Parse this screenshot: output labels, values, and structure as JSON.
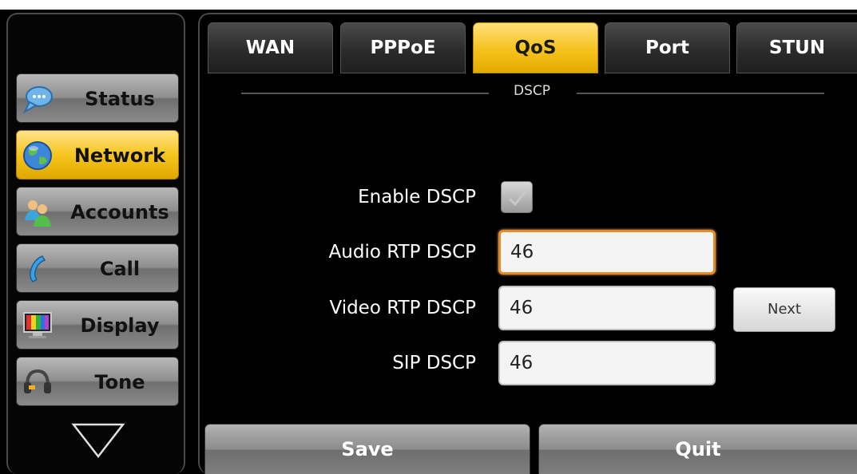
{
  "sidebar": {
    "items": [
      {
        "label": "Status",
        "icon": "speech-bubble-icon",
        "active": false
      },
      {
        "label": "Network",
        "icon": "globe-icon",
        "active": true
      },
      {
        "label": "Accounts",
        "icon": "users-icon",
        "active": false
      },
      {
        "label": "Call",
        "icon": "phone-handset-icon",
        "active": false
      },
      {
        "label": "Display",
        "icon": "monitor-icon",
        "active": false
      },
      {
        "label": "Tone",
        "icon": "headset-icon",
        "active": false
      }
    ]
  },
  "tabs": [
    {
      "label": "WAN",
      "active": false
    },
    {
      "label": "PPPoE",
      "active": false
    },
    {
      "label": "QoS",
      "active": true
    },
    {
      "label": "Port",
      "active": false
    },
    {
      "label": "STUN",
      "active": false
    }
  ],
  "section": {
    "title": "DSCP"
  },
  "form": {
    "enable_dscp": {
      "label": "Enable DSCP",
      "checked": true
    },
    "audio_rtp": {
      "label": "Audio RTP DSCP",
      "value": "46"
    },
    "video_rtp": {
      "label": "Video RTP DSCP",
      "value": "46"
    },
    "sip": {
      "label": "SIP DSCP",
      "value": "46"
    }
  },
  "next_button": {
    "label": "Next"
  },
  "footer": {
    "save_label": "Save",
    "quit_label": "Quit"
  },
  "colors": {
    "accent": "#f5c21c",
    "focus": "#e58a2b"
  }
}
